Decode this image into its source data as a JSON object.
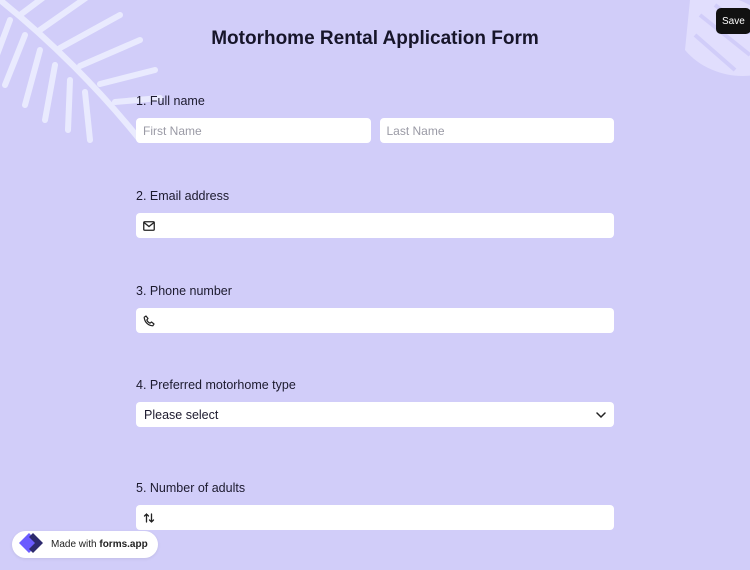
{
  "header": {
    "save_label": "Save",
    "title": "Motorhome Rental Application Form"
  },
  "questions": [
    {
      "label": "1.  Full name",
      "first_placeholder": "First Name",
      "last_placeholder": "Last Name"
    },
    {
      "label": "2. Email address",
      "icon": "envelope-icon",
      "value": ""
    },
    {
      "label": "3. Phone number",
      "icon": "phone-icon",
      "value": ""
    },
    {
      "label": "4. Preferred motorhome type",
      "selected": "Please select",
      "icon": "chevron-down-icon"
    },
    {
      "label": "5. Number of adults",
      "icon": "sort-icon",
      "value": ""
    }
  ],
  "badge": {
    "prefix": "Made with",
    "brand": "forms.app"
  },
  "colors": {
    "background": "#d1cdf9",
    "save_button": "#111111",
    "brand_purple": "#6b5cff"
  }
}
